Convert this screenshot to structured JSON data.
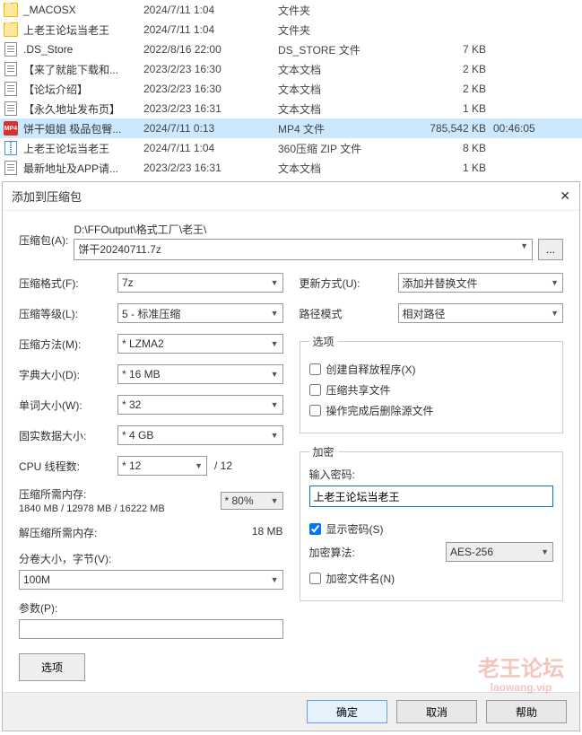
{
  "files": [
    {
      "icon": "folder",
      "name": "_MACOSX",
      "date": "2024/7/11 1:04",
      "type": "文件夹",
      "size": "",
      "dur": ""
    },
    {
      "icon": "folder",
      "name": "上老王论坛当老王",
      "date": "2024/7/11 1:04",
      "type": "文件夹",
      "size": "",
      "dur": ""
    },
    {
      "icon": "text",
      "name": ".DS_Store",
      "date": "2022/8/16 22:00",
      "type": "DS_STORE 文件",
      "size": "7 KB",
      "dur": ""
    },
    {
      "icon": "text",
      "name": "【来了就能下载和...",
      "date": "2023/2/23 16:30",
      "type": "文本文档",
      "size": "2 KB",
      "dur": ""
    },
    {
      "icon": "text",
      "name": "【论坛介绍】",
      "date": "2023/2/23 16:30",
      "type": "文本文档",
      "size": "2 KB",
      "dur": ""
    },
    {
      "icon": "text",
      "name": "【永久地址发布页】",
      "date": "2023/2/23 16:31",
      "type": "文本文档",
      "size": "1 KB",
      "dur": ""
    },
    {
      "icon": "mp4",
      "name": "饼干姐姐 极品包臀...",
      "date": "2024/7/11 0:13",
      "type": "MP4 文件",
      "size": "785,542 KB",
      "dur": "00:46:05",
      "selected": true
    },
    {
      "icon": "zip",
      "name": "上老王论坛当老王",
      "date": "2024/7/11 1:04",
      "type": "360压缩 ZIP 文件",
      "size": "8 KB",
      "dur": ""
    },
    {
      "icon": "text",
      "name": "最新地址及APP请...",
      "date": "2023/2/23 16:31",
      "type": "文本文档",
      "size": "1 KB",
      "dur": ""
    }
  ],
  "dialog": {
    "title": "添加到压缩包",
    "archive_label": "压缩包(A):",
    "archive_path": "D:\\FFOutput\\格式工厂\\老王\\",
    "archive_file": "饼干20240711.7z",
    "browse": "...",
    "format_label": "压缩格式(F):",
    "format": "7z",
    "level_label": "压缩等级(L):",
    "level": "5 - 标准压缩",
    "method_label": "压缩方法(M):",
    "method": "* LZMA2",
    "dict_label": "字典大小(D):",
    "dict": "* 16 MB",
    "word_label": "单词大小(W):",
    "word": "* 32",
    "solid_label": "固实数据大小:",
    "solid": "* 4 GB",
    "cpu_label": "CPU 线程数:",
    "cpu": "* 12",
    "cpu_total": "/ 12",
    "mem_compress_label": "压缩所需内存:",
    "mem_compress": "1840 MB / 12978 MB / 16222 MB",
    "mem_pct": "* 80%",
    "mem_decompress_label": "解压缩所需内存:",
    "mem_decompress": "18 MB",
    "split_label": "分卷大小，字节(V):",
    "split": "100M",
    "param_label": "参数(P):",
    "options_btn": "选项",
    "update_label": "更新方式(U):",
    "update": "添加并替换文件",
    "pathmode_label": "路径模式",
    "pathmode": "相对路径",
    "opts_legend": "选项",
    "opt_sfx": "创建自释放程序(X)",
    "opt_share": "压缩共享文件",
    "opt_delete": "操作完成后删除源文件",
    "enc_legend": "加密",
    "pwd_label": "输入密码:",
    "pwd_value": "上老王论坛当老王",
    "show_pwd": "显示密码(S)",
    "enc_method_label": "加密算法:",
    "enc_method": "AES-256",
    "enc_names": "加密文件名(N)",
    "ok": "确定",
    "cancel": "取消",
    "help": "帮助"
  },
  "watermark": {
    "line1": "老王论坛",
    "line2": "laowang.vip"
  }
}
